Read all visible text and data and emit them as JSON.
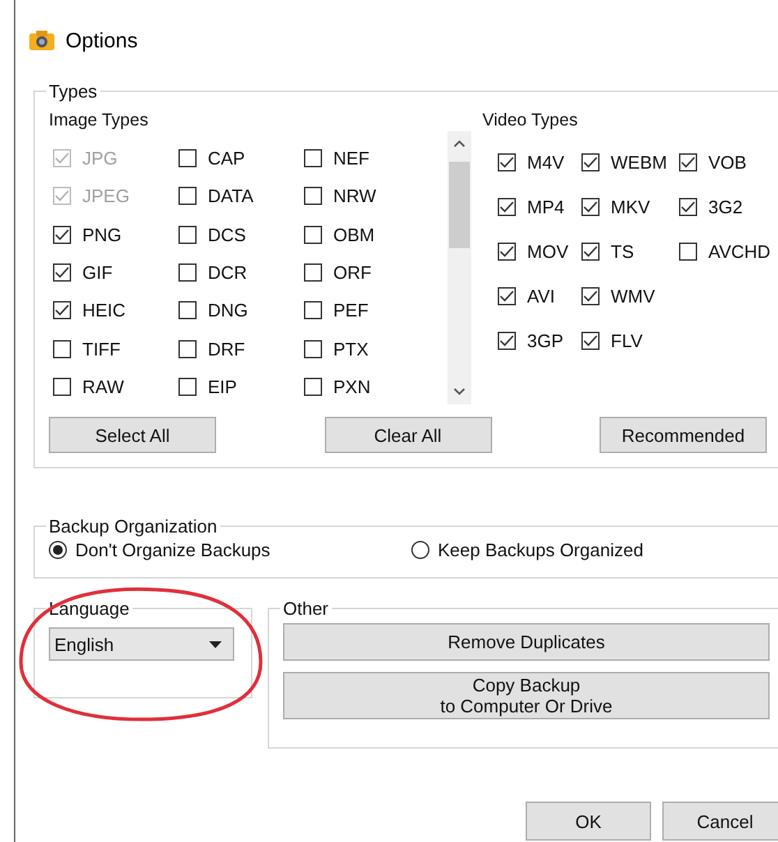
{
  "window": {
    "title": "Options"
  },
  "types": {
    "title": "Types",
    "image_types": {
      "label": "Image Types",
      "items": [
        {
          "label": "JPG",
          "checked": true,
          "disabled": true
        },
        {
          "label": "JPEG",
          "checked": true,
          "disabled": true
        },
        {
          "label": "PNG",
          "checked": true,
          "disabled": false
        },
        {
          "label": "GIF",
          "checked": true,
          "disabled": false
        },
        {
          "label": "HEIC",
          "checked": true,
          "disabled": false
        },
        {
          "label": "TIFF",
          "checked": false,
          "disabled": false
        },
        {
          "label": "RAW",
          "checked": false,
          "disabled": false
        },
        {
          "label": "CAP",
          "checked": false,
          "disabled": false
        },
        {
          "label": "DATA",
          "checked": false,
          "disabled": false
        },
        {
          "label": "DCS",
          "checked": false,
          "disabled": false
        },
        {
          "label": "DCR",
          "checked": false,
          "disabled": false
        },
        {
          "label": "DNG",
          "checked": false,
          "disabled": false
        },
        {
          "label": "DRF",
          "checked": false,
          "disabled": false
        },
        {
          "label": "EIP",
          "checked": false,
          "disabled": false
        },
        {
          "label": "NEF",
          "checked": false,
          "disabled": false
        },
        {
          "label": "NRW",
          "checked": false,
          "disabled": false
        },
        {
          "label": "OBM",
          "checked": false,
          "disabled": false
        },
        {
          "label": "ORF",
          "checked": false,
          "disabled": false
        },
        {
          "label": "PEF",
          "checked": false,
          "disabled": false
        },
        {
          "label": "PTX",
          "checked": false,
          "disabled": false
        },
        {
          "label": "PXN",
          "checked": false,
          "disabled": false
        }
      ]
    },
    "video_types": {
      "label": "Video Types",
      "items": [
        {
          "label": "M4V",
          "checked": true
        },
        {
          "label": "WEBM",
          "checked": true
        },
        {
          "label": "VOB",
          "checked": true
        },
        {
          "label": "MP4",
          "checked": true
        },
        {
          "label": "MKV",
          "checked": true
        },
        {
          "label": "3G2",
          "checked": true
        },
        {
          "label": "MOV",
          "checked": true
        },
        {
          "label": "TS",
          "checked": true
        },
        {
          "label": "AVCHD",
          "checked": false
        },
        {
          "label": "AVI",
          "checked": true
        },
        {
          "label": "WMV",
          "checked": true
        },
        {
          "label": "3GP",
          "checked": true
        },
        {
          "label": "FLV",
          "checked": true
        }
      ]
    },
    "buttons": [
      "Select All",
      "Clear All",
      "Recommended"
    ]
  },
  "backup_organization": {
    "title": "Backup Organization",
    "options": [
      {
        "label": "Don't Organize Backups",
        "selected": true
      },
      {
        "label": "Keep Backups Organized",
        "selected": false
      }
    ]
  },
  "language": {
    "title": "Language",
    "value": "English"
  },
  "other": {
    "title": "Other",
    "buttons": [
      "Remove Duplicates",
      "Copy Backup\nto Computer Or Drive"
    ]
  },
  "dialog_buttons": [
    "OK",
    "Cancel"
  ]
}
